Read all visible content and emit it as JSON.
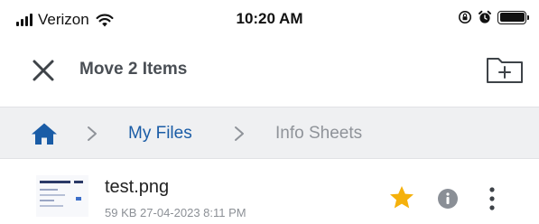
{
  "status_bar": {
    "carrier": "Verizon",
    "time": "10:20 AM",
    "icons": [
      "cellular-signal-icon",
      "wifi-icon",
      "orientation-lock-icon",
      "alarm-icon",
      "battery-icon"
    ]
  },
  "nav": {
    "title": "Move 2 Items",
    "close_icon": "close-icon",
    "new_folder_icon": "new-folder-icon"
  },
  "breadcrumb": {
    "home_icon": "home-icon",
    "items": [
      "My Files",
      "Info Sheets"
    ]
  },
  "files": [
    {
      "name": "test.png",
      "size": "59 KB",
      "date": "27-04-2023 8:11 PM",
      "starred": true
    }
  ],
  "colors": {
    "accent": "#1a5ca6",
    "title": "#4a4f55",
    "star": "#f5b10c",
    "muted": "#8f9399",
    "breadcrumb_bg": "#eff0f2"
  }
}
